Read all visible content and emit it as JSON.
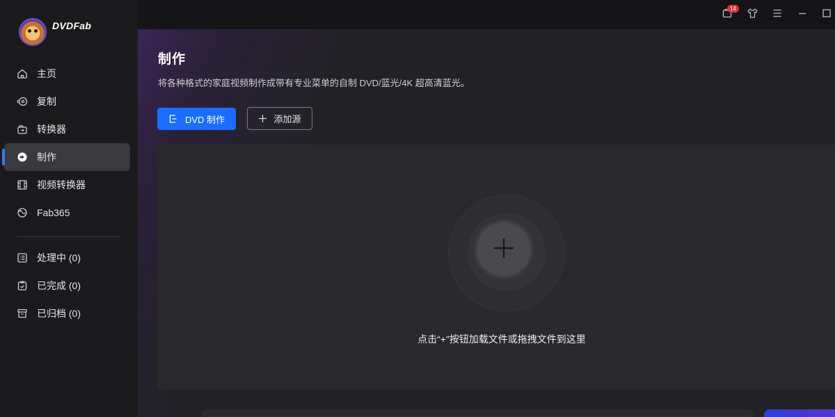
{
  "app": {
    "brand": "DVDFab"
  },
  "titlebar": {
    "notification_count": "14",
    "icons": [
      "notification-icon",
      "shirt-icon",
      "menu-icon",
      "minimize-icon",
      "maximize-icon"
    ]
  },
  "sidebar": {
    "items": [
      {
        "label": "主页",
        "icon": "home-icon"
      },
      {
        "label": "复制",
        "icon": "copy-disc-icon"
      },
      {
        "label": "转换器",
        "icon": "converter-icon"
      },
      {
        "label": "制作",
        "icon": "creator-disc-icon",
        "active": true
      },
      {
        "label": "视频转换器",
        "icon": "film-icon"
      },
      {
        "label": "Fab365",
        "icon": "fab365-icon"
      }
    ],
    "tasks": [
      {
        "label": "处理中 (0)",
        "icon": "processing-list-icon"
      },
      {
        "label": "已完成 (0)",
        "icon": "completed-clipboard-icon"
      },
      {
        "label": "已归档 (0)",
        "icon": "archive-box-icon"
      }
    ]
  },
  "main": {
    "title": "制作",
    "description": "将各种格式的家庭视频制作成带有专业菜单的自制 DVD/蓝光/4K 超高清蓝光。",
    "primary_button": "DVD 制作",
    "add_source_button": "添加源",
    "drop_hint": "点击“+”按钮加载文件或拖拽文件到这里"
  },
  "colors": {
    "accent": "#1a6dff",
    "badge": "#e0343a",
    "active_item": "#3a3a3e"
  }
}
